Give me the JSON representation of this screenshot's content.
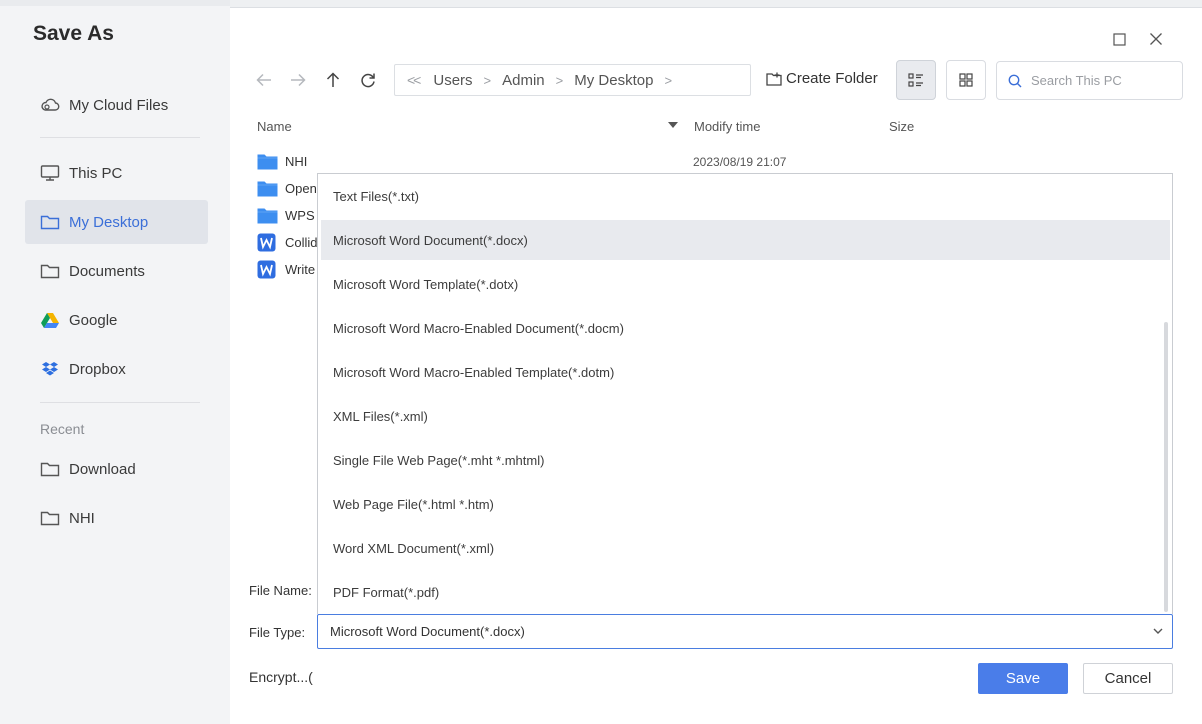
{
  "dialog": {
    "title": "Save As"
  },
  "sidebar": {
    "items": [
      {
        "label": "My Cloud Files",
        "icon": "cloud-icon"
      },
      {
        "label": "This PC",
        "icon": "monitor-icon"
      },
      {
        "label": "My Desktop",
        "icon": "folder-icon",
        "active": true
      },
      {
        "label": "Documents",
        "icon": "folder-icon"
      },
      {
        "label": "Google",
        "icon": "google-drive-icon"
      },
      {
        "label": "Dropbox",
        "icon": "dropbox-icon"
      }
    ],
    "recent_label": "Recent",
    "recent": [
      {
        "label": "Download",
        "icon": "folder-icon"
      },
      {
        "label": "NHI",
        "icon": "folder-icon"
      }
    ]
  },
  "breadcrumb": {
    "items": [
      "Users",
      "Admin",
      "My Desktop"
    ]
  },
  "toolbar": {
    "create_folder": "Create Folder"
  },
  "search": {
    "placeholder": "Search This PC"
  },
  "columns": {
    "name": "Name",
    "modify_time": "Modify time",
    "size": "Size"
  },
  "files": [
    {
      "name": "NHI",
      "type": "folder",
      "modified": "2023/08/19 21:07"
    },
    {
      "name": "Open",
      "type": "folder"
    },
    {
      "name": "WPS",
      "type": "folder"
    },
    {
      "name": "Collid",
      "type": "wps-doc"
    },
    {
      "name": "Write",
      "type": "wps-doc"
    }
  ],
  "file_types": {
    "options": [
      "Text Files(*.txt)",
      "Microsoft Word Document(*.docx)",
      "Microsoft Word Template(*.dotx)",
      "Microsoft Word Macro-Enabled Document(*.docm)",
      "Microsoft Word Macro-Enabled Template(*.dotm)",
      "XML Files(*.xml)",
      "Single File Web Page(*.mht *.mhtml)",
      "Web Page File(*.html *.htm)",
      "Word XML Document(*.xml)",
      "PDF Format(*.pdf)"
    ],
    "selected": "Microsoft Word Document(*.docx)"
  },
  "form": {
    "file_name_label": "File Name:",
    "file_type_label": "File Type:",
    "encrypt_label": "Encrypt...("
  },
  "buttons": {
    "save": "Save",
    "cancel": "Cancel"
  },
  "colors": {
    "accent": "#4a7de9",
    "folder": "#3d8ef0",
    "sidebar_bg": "#f3f4f6"
  }
}
